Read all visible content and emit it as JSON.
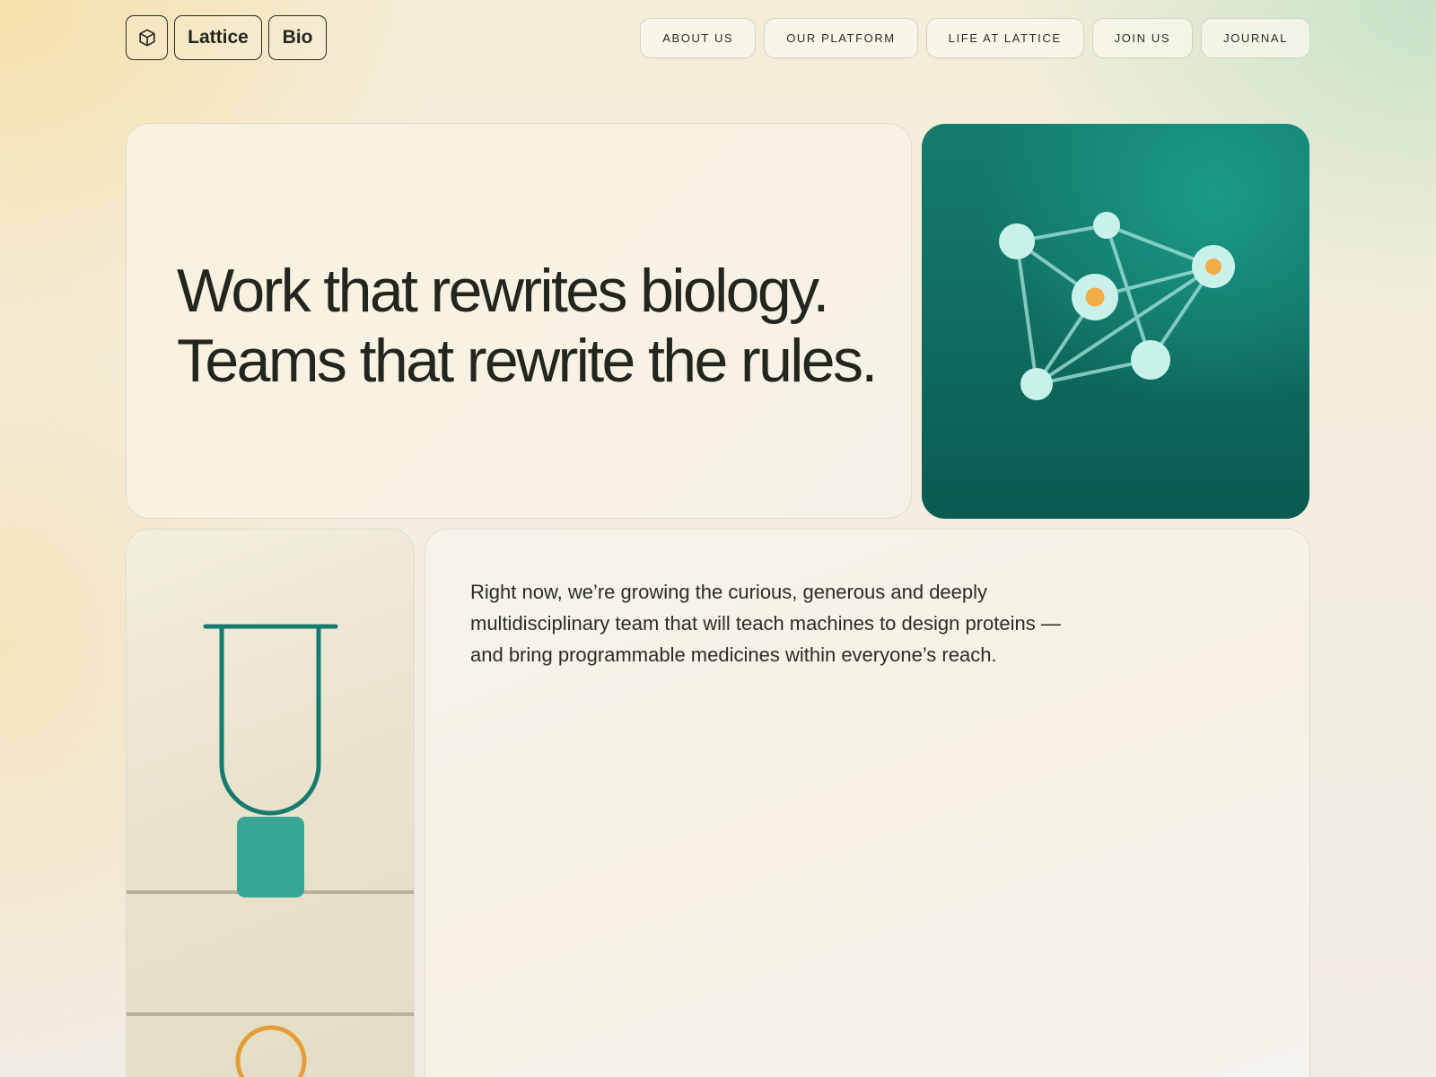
{
  "brand": {
    "icon": "cube-icon",
    "word1": "Lattice",
    "word2": "Bio"
  },
  "nav": {
    "items": [
      {
        "label": "ABOUT US"
      },
      {
        "label": "OUR PLATFORM"
      },
      {
        "label": "LIFE AT LATTICE"
      },
      {
        "label": "JOIN US"
      },
      {
        "label": "JOURNAL"
      }
    ]
  },
  "hero": {
    "line1": "Work that rewrites biology.",
    "line2": "Teams that rewrite the rules."
  },
  "intro": {
    "text": "Right now, we’re growing the curious, generous and deeply multidisciplinary team that will teach machines to design proteins — and bring programmable medicines within everyone’s reach."
  },
  "colors": {
    "teal": "#147c6e",
    "node": "#c9f1ea",
    "accent": "#f2ac45",
    "ink": "#23271f"
  }
}
